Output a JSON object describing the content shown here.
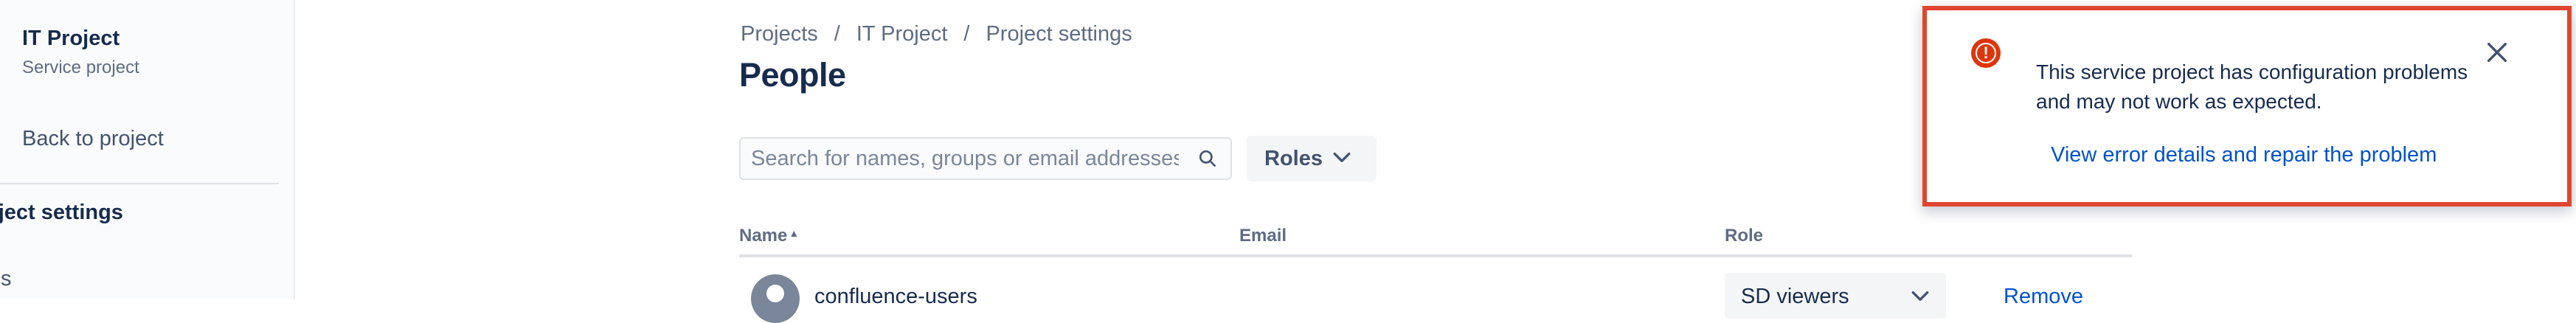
{
  "sidebar": {
    "project_name": "IT Project",
    "project_type": "Service project",
    "back_link": "Back to project",
    "section_title": "oject settings",
    "item": "ails"
  },
  "breadcrumb": [
    "Projects",
    "IT Project",
    "Project settings"
  ],
  "breadcrumb_sep": "/",
  "page_title": "People",
  "search": {
    "placeholder": "Search for names, groups or email addresses",
    "value": ""
  },
  "roles_button": "Roles",
  "table": {
    "headers": {
      "name": "Name",
      "email": "Email",
      "role": "Role"
    },
    "rows": [
      {
        "name": "confluence-users",
        "role": "SD viewers",
        "action": "Remove"
      }
    ]
  },
  "flag": {
    "message": "This service project has configuration problems and may not work as expected.",
    "link": "View error details and repair the problem",
    "border_color": "#e0452d",
    "icon": "error-icon"
  },
  "colors": {
    "link": "#0052cc",
    "text": "#172b4d",
    "muted": "#5e6c84"
  }
}
